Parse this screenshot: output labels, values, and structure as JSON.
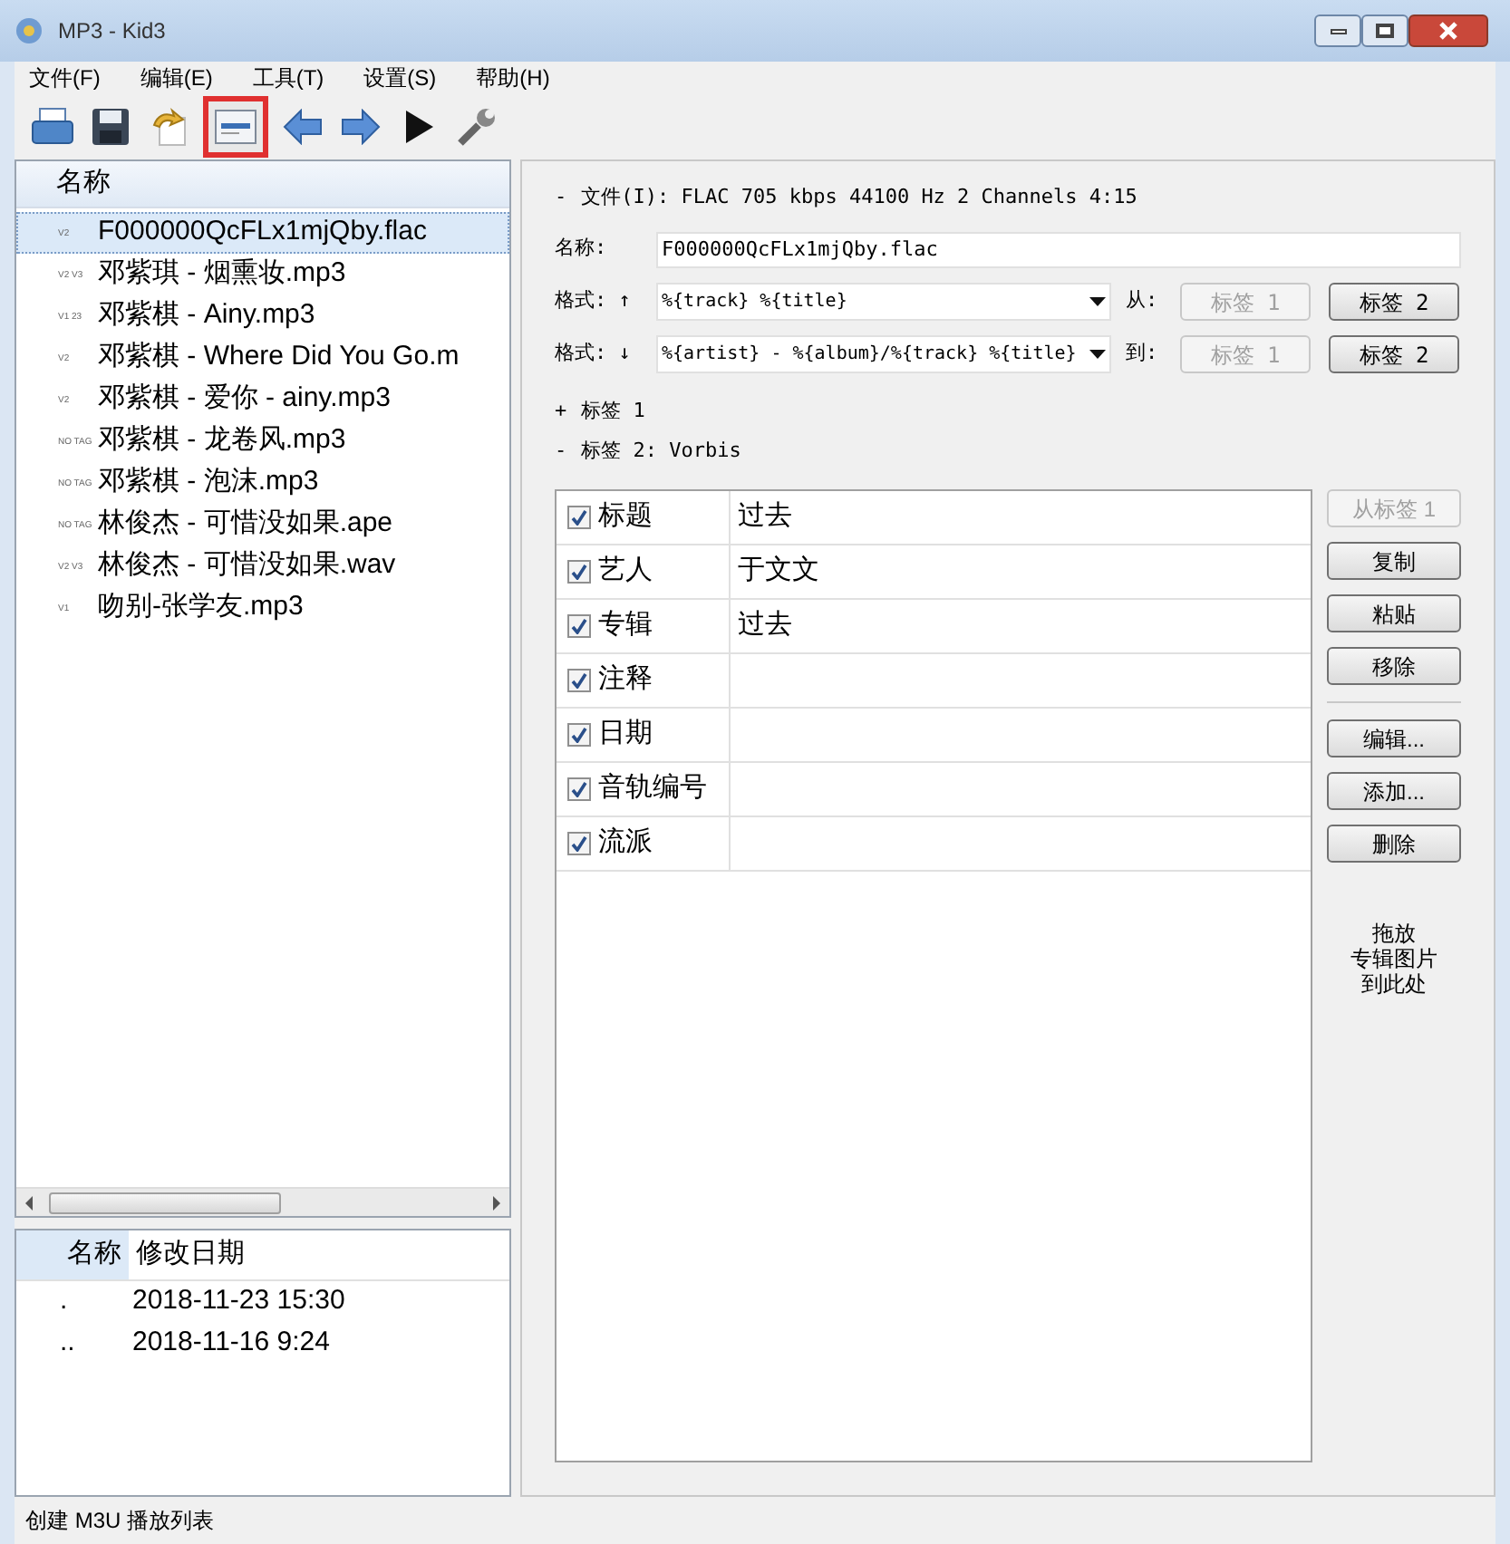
{
  "window": {
    "title": "MP3 - Kid3"
  },
  "menu": [
    "文件(F)",
    "编辑(E)",
    "工具(T)",
    "设置(S)",
    "帮助(H)"
  ],
  "toolbar": [
    {
      "kind": "open",
      "highlighted": false
    },
    {
      "kind": "save",
      "highlighted": false
    },
    {
      "kind": "revert",
      "highlighted": false
    },
    {
      "kind": "filter",
      "highlighted": true
    },
    {
      "kind": "previous",
      "highlighted": false
    },
    {
      "kind": "next",
      "highlighted": false
    },
    {
      "kind": "play",
      "highlighted": false
    },
    {
      "kind": "settings",
      "highlighted": false
    }
  ],
  "file_list": {
    "column": "名称",
    "rows": [
      {
        "badge": "V2",
        "name": "F000000QcFLx1mjQby.flac",
        "selected": true
      },
      {
        "badge": "V2 V3",
        "name": "邓紫琪 - 烟熏妆.mp3",
        "selected": false
      },
      {
        "badge": "V1 23",
        "name": "邓紫棋 - Ainy.mp3",
        "selected": false
      },
      {
        "badge": "V2",
        "name": "邓紫棋 - Where Did You Go.m",
        "selected": false
      },
      {
        "badge": "V2",
        "name": "邓紫棋 - 爱你 - ainy.mp3",
        "selected": false
      },
      {
        "badge": "NO TAG",
        "name": "邓紫棋 - 龙卷风.mp3",
        "selected": false
      },
      {
        "badge": "NO TAG",
        "name": "邓紫棋 - 泡沫.mp3",
        "selected": false
      },
      {
        "badge": "NO TAG",
        "name": "林俊杰 - 可惜没如果.ape",
        "selected": false
      },
      {
        "badge": "V2 V3",
        "name": "林俊杰 - 可惜没如果.wav",
        "selected": false
      },
      {
        "badge": "V1",
        "name": "吻别-张学友.mp3",
        "selected": false
      }
    ]
  },
  "dir_list": {
    "columns": [
      "名称",
      "修改日期"
    ],
    "rows": [
      {
        "name": ".",
        "date": "2018-11-23 15:30"
      },
      {
        "name": "..",
        "date": "2018-11-16 9:24"
      }
    ]
  },
  "file_section": {
    "toggle": "-",
    "label": "文件(I): FLAC 705 kbps 44100 Hz 2 Channels 4:15"
  },
  "name_field": {
    "label": "名称:",
    "value": "F000000QcFLx1mjQby.flac"
  },
  "format_rows": [
    {
      "label": "格式: ↑",
      "value": "%{track} %{title}",
      "direction_label": "从:",
      "buttons": [
        {
          "label": "标签 1",
          "disabled": true
        },
        {
          "label": "标签 2",
          "disabled": false
        }
      ]
    },
    {
      "label": "格式: ↓",
      "value": "%{artist} - %{album}/%{track} %{title}",
      "direction_label": "到:",
      "buttons": [
        {
          "label": "标签 1",
          "disabled": true
        },
        {
          "label": "标签 2",
          "disabled": false
        }
      ]
    }
  ],
  "tag1_section": {
    "toggle": "+",
    "label": "标签 1"
  },
  "tag2_section": {
    "toggle": "-",
    "label": "标签 2: Vorbis"
  },
  "frames": [
    {
      "name": "标题",
      "value": "过去",
      "checked": true
    },
    {
      "name": "艺人",
      "value": "于文文",
      "checked": true
    },
    {
      "name": "专辑",
      "value": "过去",
      "checked": true
    },
    {
      "name": "注释",
      "checked": true
    },
    {
      "name": "日期",
      "checked": true
    },
    {
      "name": "音轨编号",
      "checked": true
    },
    {
      "name": "流派",
      "checked": true
    }
  ],
  "side_buttons": [
    {
      "label": "从标签 1",
      "disabled": true
    },
    {
      "label": "复制",
      "disabled": false
    },
    {
      "label": "粘贴",
      "disabled": false
    },
    {
      "label": "移除",
      "disabled": false
    },
    {
      "label": "编辑...",
      "disabled": false,
      "separator_before": true
    },
    {
      "label": "添加...",
      "disabled": false
    },
    {
      "label": "删除",
      "disabled": false
    }
  ],
  "drop_hint": [
    "拖放",
    "专辑图片",
    "到此处"
  ],
  "status_bar": "创建 M3U 播放列表"
}
